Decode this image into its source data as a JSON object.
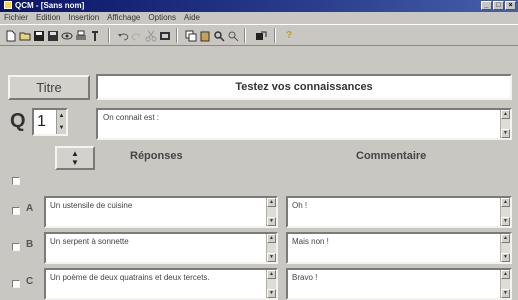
{
  "window": {
    "title": "QCM - [Sans nom]"
  },
  "menu": [
    "Fichier",
    "Edition",
    "Insertion",
    "Affichage",
    "Options",
    "Aide"
  ],
  "toolbar": {
    "icons": [
      "new-icon",
      "open-icon",
      "save-icon",
      "save-all-icon",
      "preview-icon",
      "print-icon",
      "insert-icon",
      "undo-icon",
      "redo-icon",
      "cut-icon",
      "media-icon",
      "copy-icon",
      "paste-icon",
      "find-icon",
      "replace-icon",
      "export-icon",
      "help-icon"
    ]
  },
  "titre": {
    "label": "Titre",
    "value": "Testez vos connaissances"
  },
  "question": {
    "letter": "Q",
    "number": "1",
    "text": "On connait est :"
  },
  "headers": {
    "reponses": "Réponses",
    "commentaire": "Commentaire"
  },
  "answers": [
    {
      "letter": "A",
      "reponse": "Un ustensile de cuisine",
      "commentaire": "Oh !"
    },
    {
      "letter": "B",
      "reponse": "Un serpent à sonnette",
      "commentaire": "Mais non !"
    },
    {
      "letter": "C",
      "reponse": "Un poème de deux quatrains et deux tercets.",
      "commentaire": "Bravo !"
    }
  ]
}
